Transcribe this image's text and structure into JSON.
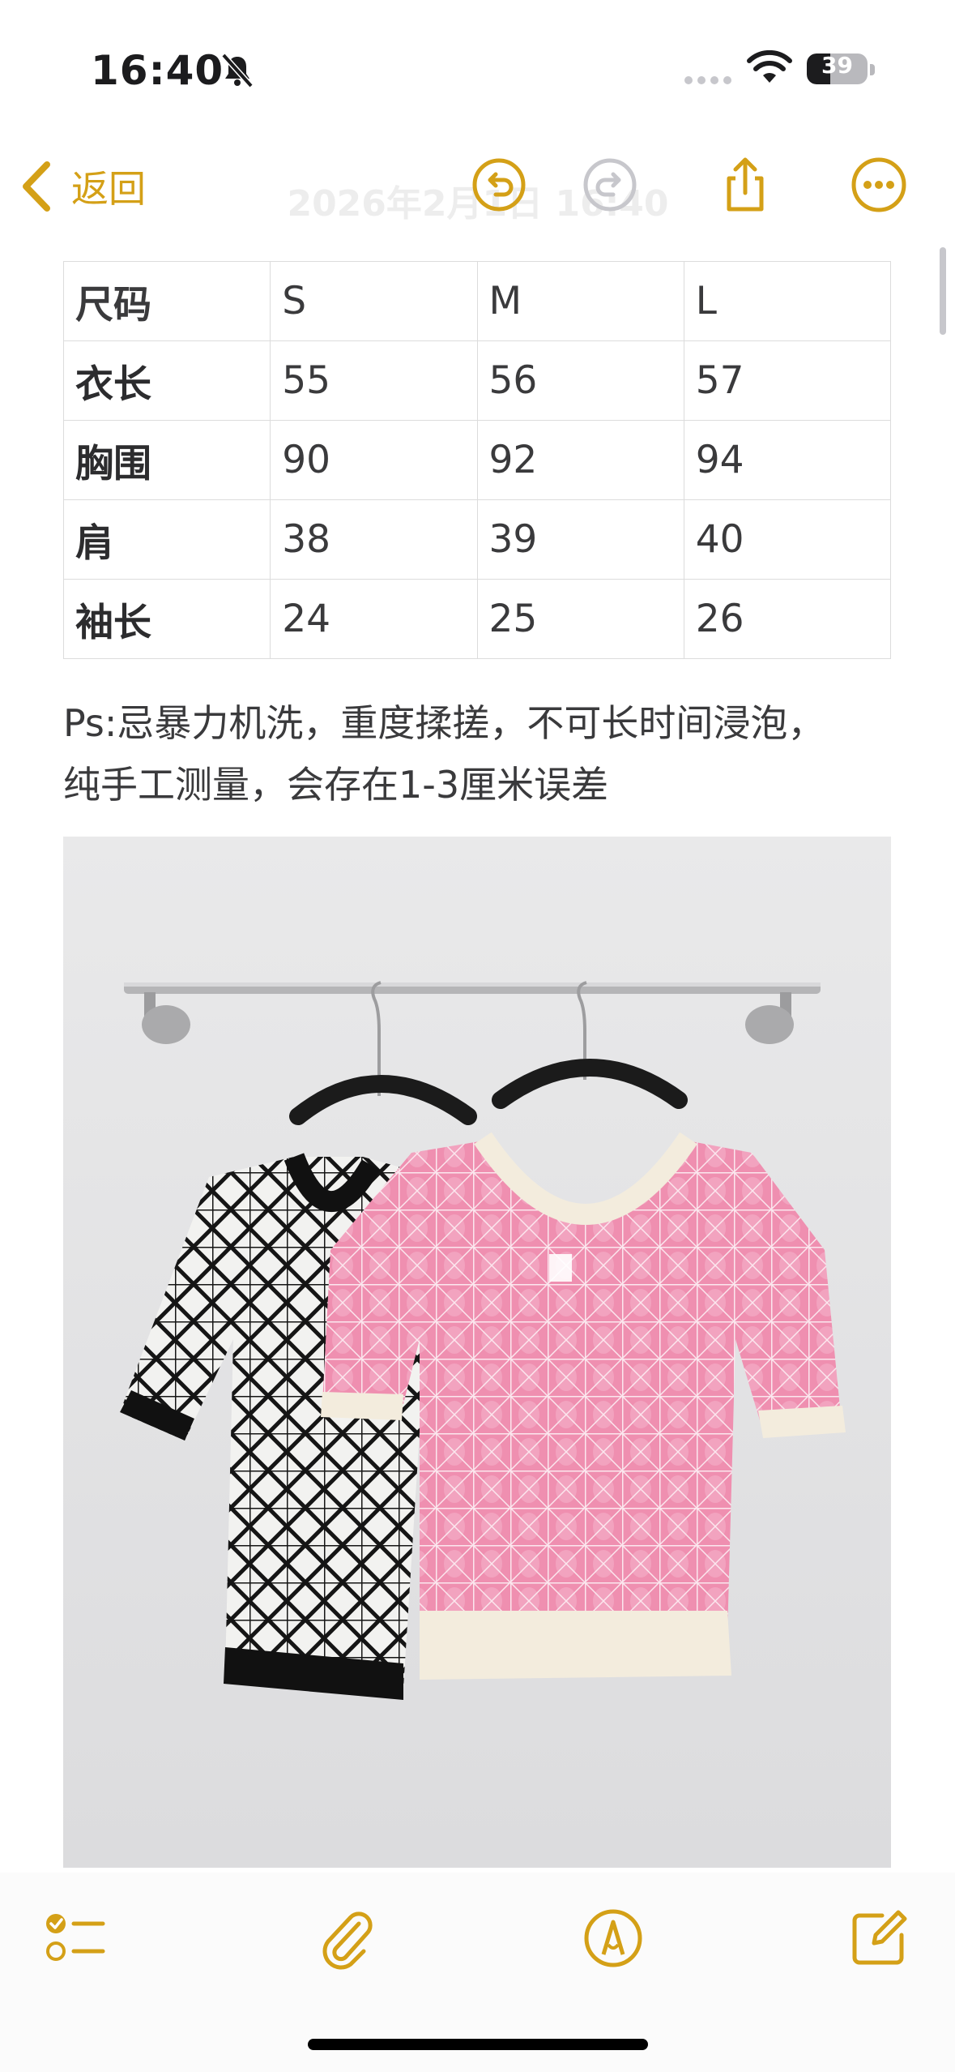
{
  "status_bar": {
    "time": "16:40",
    "battery": "39",
    "battery_level": 0.39,
    "icons": [
      "bell-slash-icon",
      "cellular-dots-icon",
      "wifi-icon",
      "battery-icon"
    ]
  },
  "nav": {
    "back_label": "返回",
    "title": "2026年2月1日 16:40",
    "buttons": [
      "undo-icon",
      "redo-icon",
      "share-icon",
      "more-icon"
    ]
  },
  "size_table": {
    "header": [
      "尺码",
      "S",
      "M",
      "L"
    ],
    "rows": [
      [
        "衣长",
        "55",
        "56",
        "57"
      ],
      [
        "胸围",
        "90",
        "92",
        "94"
      ],
      [
        "肩",
        "38",
        "39",
        "40"
      ],
      [
        "袖长",
        "24",
        "25",
        "26"
      ]
    ]
  },
  "note": {
    "line1": "Ps:忌暴力机洗，重度揉搓，不可长时间浸泡，",
    "line2": "纯手工测量，会存在1-3厘米误差"
  },
  "toolbar": {
    "buttons": [
      "checklist-icon",
      "paperclip-icon",
      "markup-pen-icon",
      "compose-icon"
    ]
  },
  "colors": {
    "accent": "#d4a017",
    "text": "#3a3a3c",
    "border": "#dcdcdc"
  }
}
